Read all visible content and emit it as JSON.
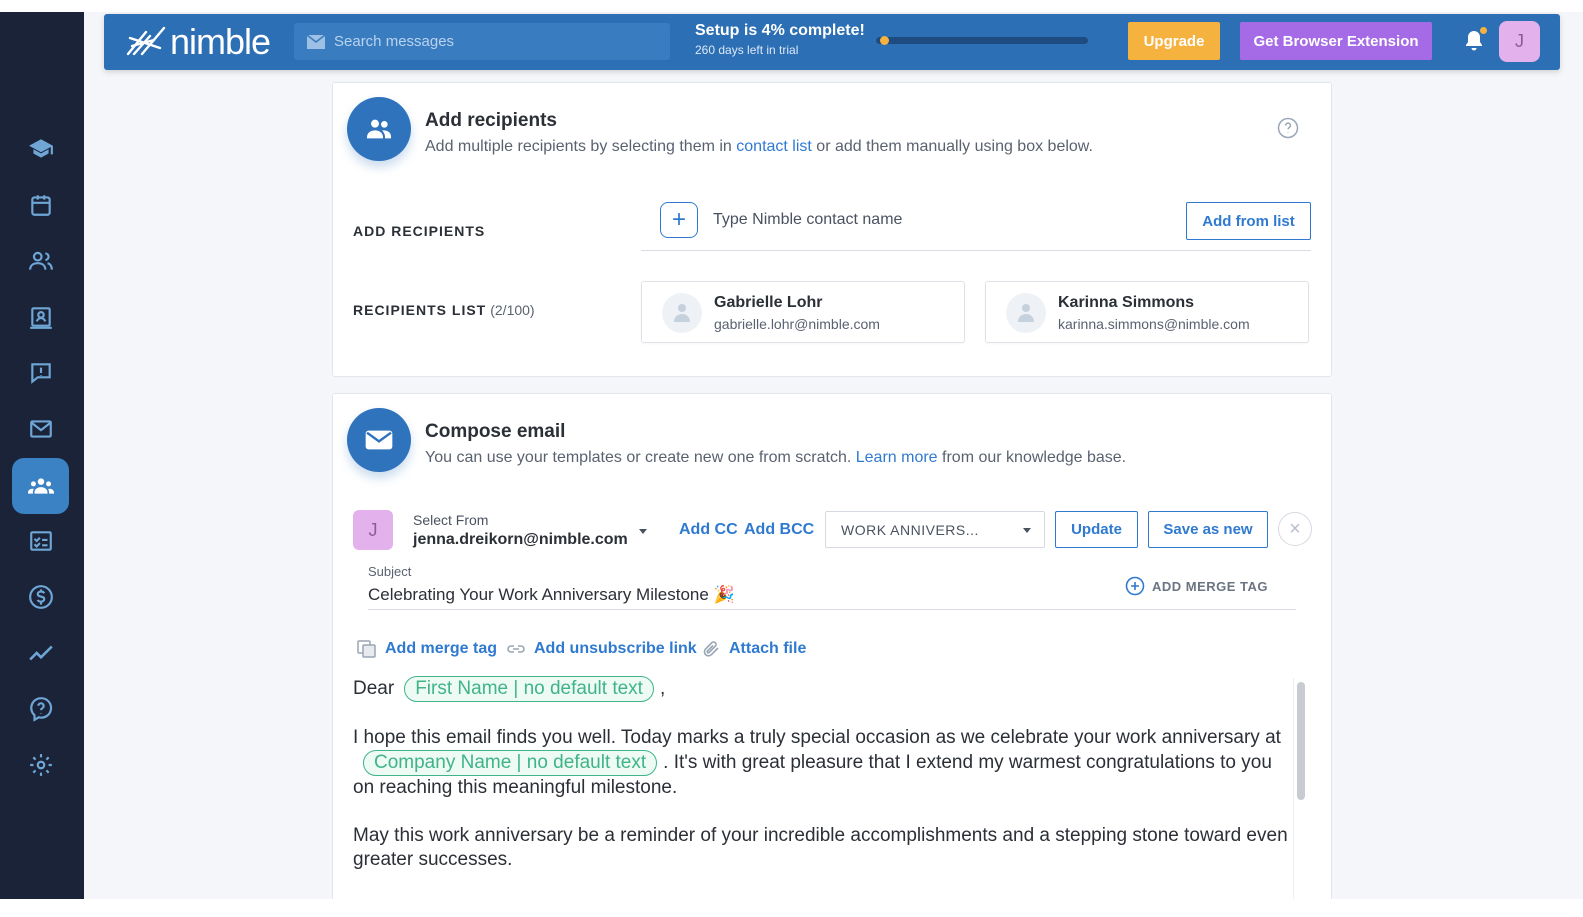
{
  "topbar": {
    "logo_text": "nimble",
    "search_placeholder": "Search messages",
    "setup_title": "Setup is 4% complete!",
    "setup_subtitle": "260 days left in trial",
    "setup_progress_fraction": 0.04,
    "upgrade_label": "Upgrade",
    "extension_label": "Get Browser Extension",
    "avatar_initial": "J"
  },
  "sidebar": {
    "items": [
      {
        "icon": "graduation-cap-icon"
      },
      {
        "icon": "calendar-icon"
      },
      {
        "icon": "people-icon"
      },
      {
        "icon": "contact-card-icon"
      },
      {
        "icon": "alert-message-icon"
      },
      {
        "icon": "mail-icon"
      },
      {
        "icon": "group-message-icon",
        "active": true
      },
      {
        "icon": "tasks-icon"
      },
      {
        "icon": "dollar-icon"
      },
      {
        "icon": "chart-line-icon"
      },
      {
        "icon": "help-icon"
      },
      {
        "icon": "settings-icon"
      }
    ]
  },
  "recipients": {
    "title": "Add recipients",
    "desc_before": "Add multiple recipients by selecting them in ",
    "desc_link": "contact list",
    "desc_after": " or add them manually using box below.",
    "add_label": "ADD RECIPIENTS",
    "input_placeholder": "Type Nimble contact name",
    "add_from_list": "Add from list",
    "list_label": "RECIPIENTS LIST",
    "list_count": "(2/100)",
    "list": [
      {
        "name": "Gabrielle Lohr",
        "email": "gabrielle.lohr@nimble.com"
      },
      {
        "name": "Karinna Simmons",
        "email": "karinna.simmons@nimble.com"
      }
    ]
  },
  "compose": {
    "title": "Compose email",
    "desc_before": "You can use your templates or create new one from scratch. ",
    "desc_link": "Learn more",
    "desc_after": " from our knowledge base.",
    "from_avatar": "J",
    "from_label": "Select From",
    "from_value": "jenna.dreikorn@nimble.com",
    "add_cc": "Add CC",
    "add_bcc": "Add BCC",
    "template": "WORK ANNIVERS...",
    "update": "Update",
    "save_as_new": "Save as new",
    "close": "×",
    "subject_label": "Subject",
    "subject": "Celebrating Your Work Anniversary Milestone 🎉",
    "add_merge_tag_caps": "ADD MERGE TAG",
    "tools": {
      "merge_tag": "Add merge tag",
      "unsubscribe": "Add unsubscribe link",
      "attach": "Attach file"
    },
    "body": {
      "greeting": "Dear",
      "first_name_tag": "First Name | no default text",
      "comma": ",",
      "p1_before": "I hope this email finds you well. Today marks a truly special occasion as we celebrate your work anniversary at",
      "company_tag": "Company Name | no default text",
      "p1_after": ". It's with great pleasure that I extend my warmest congratulations to you on reaching this meaningful milestone.",
      "p2": "May this work anniversary be a reminder of your incredible accomplishments and a stepping stone toward even greater successes."
    }
  }
}
